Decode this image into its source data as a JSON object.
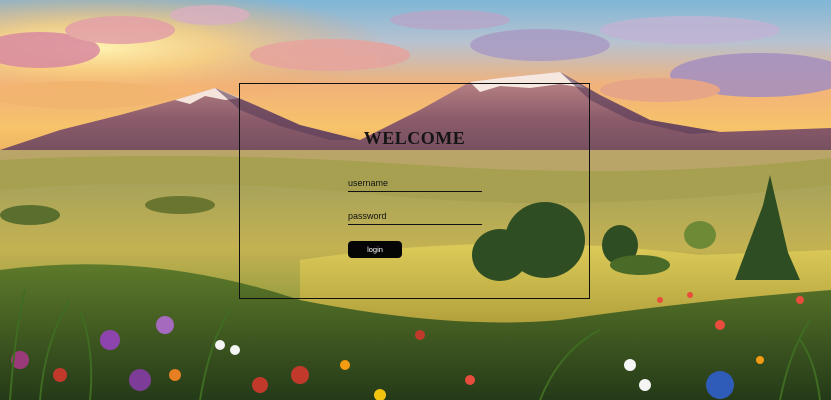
{
  "login_form": {
    "title": "WELCOME",
    "username_placeholder": "username",
    "password_placeholder": "password",
    "login_label": "login"
  },
  "colors": {
    "button_background": "#050505",
    "button_text": "#ffffff",
    "form_border": "#111111",
    "title_text": "#141414"
  }
}
